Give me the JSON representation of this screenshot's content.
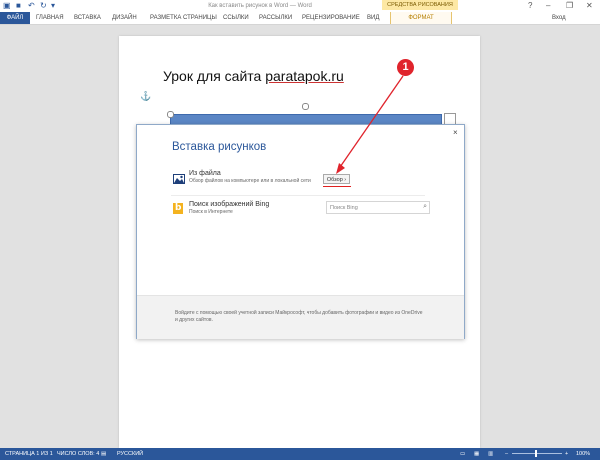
{
  "titlebar": {
    "doc_title": "Как вставить рисунок в Word — Word",
    "context_tab": "СРЕДСТВА РИСОВАНИЯ",
    "minimize": "–",
    "restore": "❐",
    "close": "✕",
    "help": "?"
  },
  "ribbon": {
    "tabs": {
      "file": "ФАЙЛ",
      "home": "ГЛАВНАЯ",
      "insert": "ВСТАВКА",
      "design": "ДИЗАЙН",
      "layout": "РАЗМЕТКА СТРАНИЦЫ",
      "references": "ССЫЛКИ",
      "mailings": "РАССЫЛКИ",
      "review": "РЕЦЕНЗИРОВАНИЕ",
      "view": "ВИД",
      "format": "ФОРМАТ"
    },
    "user": "Вход"
  },
  "document": {
    "heading_prefix": "Урок для сайта ",
    "heading_site": "paratapok.ru"
  },
  "dialog": {
    "title": "Вставка рисунков",
    "close": "×",
    "from_file": {
      "title": "Из файла",
      "description": "Обзор файлов на компьютере или в локальной сети",
      "browse_button": "Обзор ›"
    },
    "bing": {
      "title": "Поиск изображений Bing",
      "description": "Поиск в Интернете",
      "search_placeholder": "Поиск Bing",
      "logo_letter": "b"
    },
    "footer_text": "Войдите с помощью своей учетной записи Майкрософт, чтобы добавить фотографии и видео из OneDrive и других сайтов."
  },
  "callout": {
    "number": "1"
  },
  "statusbar": {
    "pages": "СТРАНИЦА 1 ИЗ 1",
    "words": "ЧИСЛО СЛОВ: 4",
    "language": "РУССКИЙ",
    "zoom": "100%",
    "zoom_out": "–",
    "zoom_in": "+"
  },
  "colors": {
    "accent": "#2b579a",
    "context_tab": "#fde8a4",
    "annotation_red": "#e0242c"
  }
}
